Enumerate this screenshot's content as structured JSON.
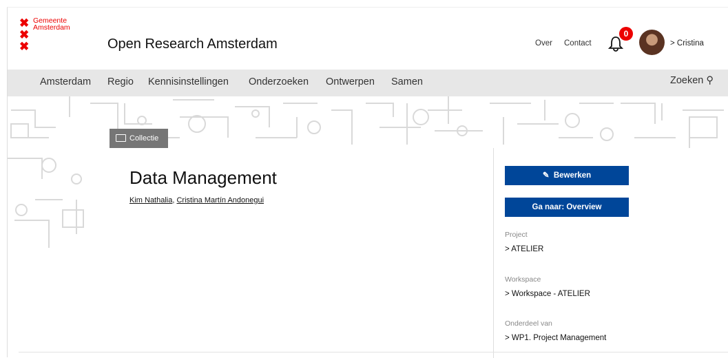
{
  "header": {
    "logo_text": "Gemeente Amsterdam",
    "site_title": "Open Research Amsterdam",
    "links": [
      "Over",
      "Contact"
    ],
    "notification_count": "0",
    "user_link": "> Cristina"
  },
  "nav": {
    "items": [
      "Amsterdam",
      "Regio",
      "Kennisinstellingen",
      "Onderzoeken",
      "Ontwerpen",
      "Samen"
    ],
    "search_label": "Zoeken ⚲"
  },
  "collection": {
    "tag": "Collectie",
    "title": "Data Management",
    "authors": [
      "Kim Nathalia",
      "Cristina Martín Andonegui"
    ]
  },
  "sidebar": {
    "edit_label": "Bewerken",
    "goto_label": "Ga naar: Overview",
    "project_label": "Project",
    "project_value": "> ATELIER",
    "workspace_label": "Workspace",
    "workspace_value": "> Workspace - ATELIER",
    "part_of_label": "Onderdeel van",
    "part_of_value": "> WP1. Project Management"
  },
  "colors": {
    "brand_red": "#ec0000",
    "button_blue": "#004699",
    "nav_bg": "#e7e7e7",
    "tag_gray": "#767676"
  }
}
